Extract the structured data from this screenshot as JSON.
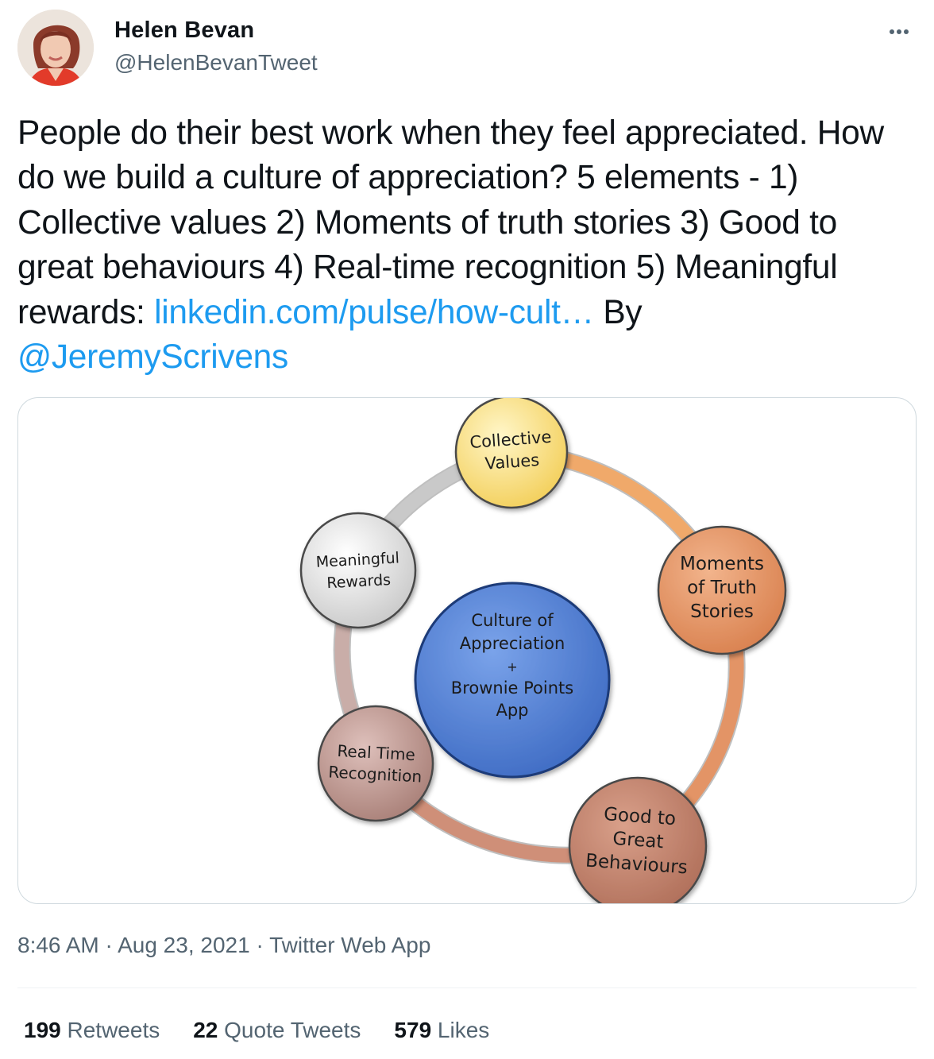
{
  "author": {
    "name": "Helen Bevan",
    "handle": "@HelenBevanTweet"
  },
  "tweet": {
    "text_before_link": "People do their best work when they feel appreciated. How do we build a culture of appreciation? 5 elements - 1) Collective values 2) Moments of truth stories 3) Good to great behaviours 4) Real-time recognition 5) Meaningful rewards: ",
    "link_text": "linkedin.com/pulse/how-cult…",
    "text_after_link": " By ",
    "mention": "@JeremyScrivens"
  },
  "diagram": {
    "center": [
      "Culture of",
      "Appreciation",
      "+",
      "Brownie Points",
      "App"
    ],
    "nodes": [
      {
        "name": "collective-values-node",
        "lines": [
          "Collective",
          "Values"
        ],
        "color": "#f8df7e"
      },
      {
        "name": "moments-of-truth-node",
        "lines": [
          "Moments",
          "of Truth",
          "Stories"
        ],
        "color": "#e49a6e"
      },
      {
        "name": "good-to-great-node",
        "lines": [
          "Good to",
          "Great",
          "Behaviours"
        ],
        "color": "#c58b75"
      },
      {
        "name": "real-time-recognition-node",
        "lines": [
          "Real Time",
          "Recognition"
        ],
        "color": "#c9a5a0"
      },
      {
        "name": "meaningful-rewards-node",
        "lines": [
          "Meaningful",
          "Rewards"
        ],
        "color": "#ececec"
      }
    ],
    "center_color": "#5b86d6",
    "arc_colors": [
      "#f0a96a",
      "#e39466",
      "#cf8f78",
      "#c9ada8",
      "#c9c9c9"
    ]
  },
  "meta": {
    "time": "8:46 AM",
    "date": "Aug 23, 2021",
    "source": "Twitter Web App",
    "separator": "·"
  },
  "stats": {
    "retweets_count": "199",
    "retweets_label": "Retweets",
    "quotes_count": "22",
    "quotes_label": "Quote Tweets",
    "likes_count": "579",
    "likes_label": "Likes"
  },
  "colors": {
    "link": "#1d9bf0",
    "secondary_text": "#536471",
    "border": "#cfd9de"
  },
  "icons": {
    "more": "more-horizontal-icon"
  }
}
